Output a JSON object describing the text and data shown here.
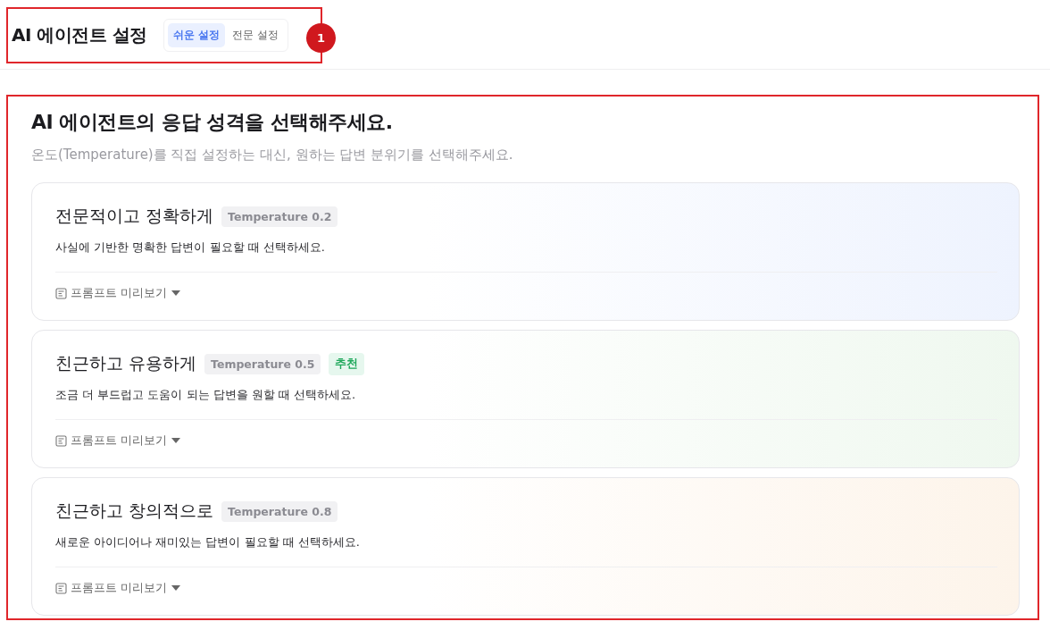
{
  "header": {
    "title": "AI 에이전트 설정",
    "tabs": [
      {
        "label": "쉬운 설정",
        "selected": true
      },
      {
        "label": "전문 설정",
        "selected": false
      }
    ],
    "marker": "1"
  },
  "main": {
    "title": "AI 에이전트의 응답 성격을 선택해주세요.",
    "subtitle": "온도(Temperature)를 직접 설정하는 대신, 원하는 답변 분위기를 선택해주세요.",
    "options": [
      {
        "title": "전문적이고 정확하게",
        "temperature": "Temperature 0.2",
        "description": "사실에 기반한 명확한 답변이 필요할 때 선택하세요.",
        "preview": "프롬프트 미리보기",
        "color": "#eef3fe"
      },
      {
        "title": "친근하고 유용하게",
        "temperature": "Temperature 0.5",
        "badge": "추천",
        "description": "조금 더 부드럽고 도움이 되는 답변을 원할 때 선택하세요.",
        "preview": "프롬프트 미리보기",
        "color": "#eff8ef"
      },
      {
        "title": "친근하고 창의적으로",
        "temperature": "Temperature 0.8",
        "description": "새로운 아이디어나 재미있는 답변이 필요할 때 선택하세요.",
        "preview": "프롬프트 미리보기",
        "color": "#fdf4ea"
      }
    ]
  }
}
